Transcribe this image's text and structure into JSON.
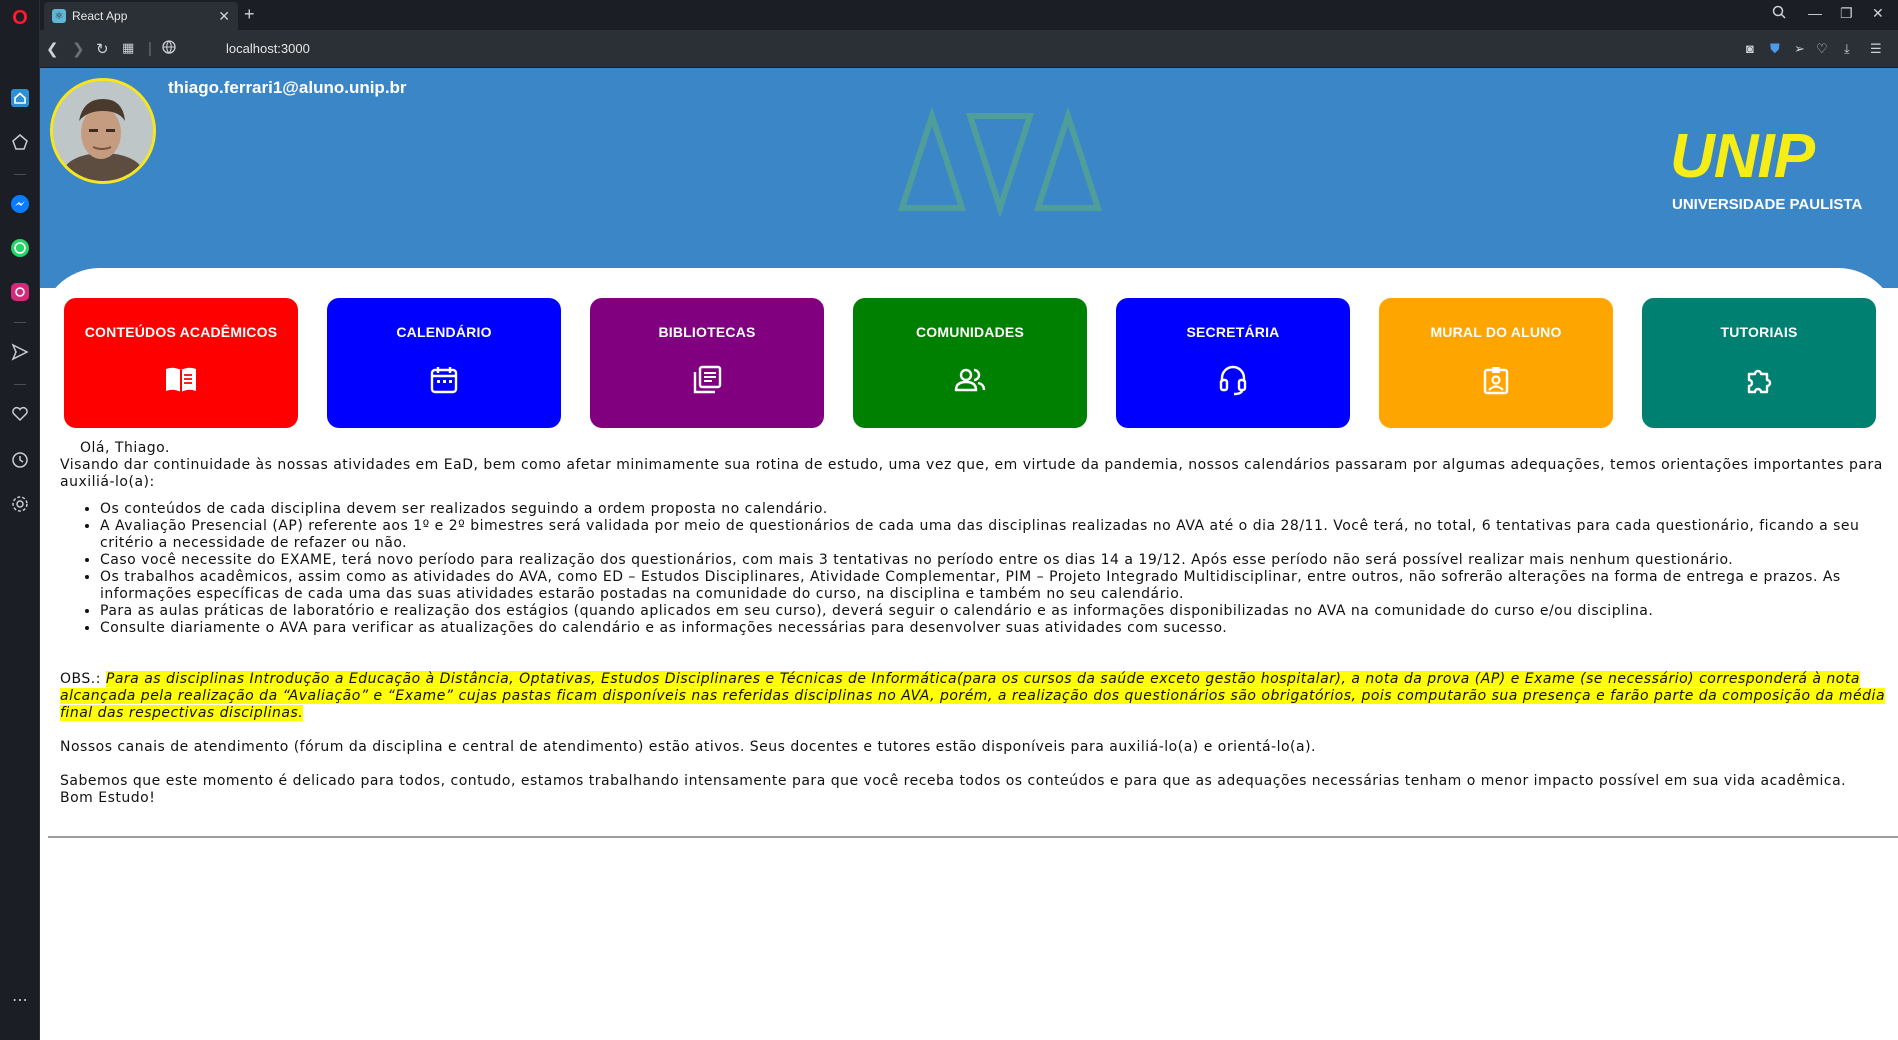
{
  "browser": {
    "tab_title": "React App",
    "url": "localhost:3000"
  },
  "header": {
    "user_email": "thiago.ferrari1@aluno.unip.br",
    "center_logo": "AVA",
    "brand_title": "UNIP",
    "brand_subtitle": "UNIVERSIDADE PAULISTA"
  },
  "nav_cards": [
    {
      "label": "CONTEÚDOS ACADÊMICOS",
      "color": "#ff0000",
      "icon": "book-open-icon"
    },
    {
      "label": "CALENDÁRIO",
      "color": "#0000ff",
      "icon": "calendar-icon"
    },
    {
      "label": "BIBLIOTECAS",
      "color": "#800080",
      "icon": "library-icon"
    },
    {
      "label": "COMUNIDADES",
      "color": "#008000",
      "icon": "people-icon"
    },
    {
      "label": "SECRETÁRIA",
      "color": "#0000ff",
      "icon": "headset-icon"
    },
    {
      "label": "MURAL DO ALUNO",
      "color": "#ffa500",
      "icon": "badge-icon"
    },
    {
      "label": "TUTORIAIS",
      "color": "#008070",
      "icon": "puzzle-icon"
    }
  ],
  "message": {
    "greeting": "Olá, Thiago.",
    "intro": "Visando dar continuidade às nossas atividades em EaD, bem como afetar minimamente sua rotina de estudo, uma vez que, em virtude da pandemia, nossos calendários passaram por algumas adequações, temos orientações importantes para auxiliá-lo(a):",
    "items": [
      "Os conteúdos de cada disciplina devem ser realizados seguindo a ordem proposta no calendário.",
      "A Avaliação Presencial (AP) referente aos 1º e 2º bimestres será validada por meio de questionários de cada uma das disciplinas realizadas no AVA até o dia 28/11. Você terá, no total, 6 tentativas para cada questionário, ficando a seu critério a necessidade de refazer ou não.",
      "Caso você necessite do EXAME, terá novo período para realização dos questionários, com mais 3 tentativas no período entre os dias 14 a 19/12. Após esse período não será possível realizar mais nenhum questionário.",
      "Os trabalhos acadêmicos, assim como as atividades do AVA, como ED – Estudos Disciplinares, Atividade Complementar, PIM – Projeto Integrado Multidisciplinar, entre outros, não sofrerão alterações na forma de entrega e prazos. As informações específicas de cada uma das suas atividades estarão postadas na comunidade do curso, na disciplina e também no seu calendário.",
      "Para as aulas práticas de laboratório e realização dos estágios (quando aplicados em seu curso), deverá seguir o calendário e as informações disponibilizadas no AVA na comunidade do curso e/ou disciplina.",
      "Consulte diariamente o AVA para verificar as atualizações do calendário e as informações necessárias para desenvolver suas atividades com sucesso."
    ],
    "obs_label": "OBS.:",
    "obs_text": "Para as disciplinas Introdução a Educação à Distância, Optativas, Estudos Disciplinares e Técnicas de Informática(para os cursos da saúde exceto gestão hospitalar), a nota da prova (AP) e Exame (se necessário) corresponderá à nota alcançada pela realização da “Avaliação” e “Exame” cujas pastas ficam disponíveis nas referidas disciplinas no AVA, porém, a realização dos questionários são obrigatórios, pois computarão sua presença e farão parte da composição da média final das respectivas disciplinas.",
    "channels": "Nossos canais de atendimento (fórum da disciplina e central de atendimento) estão ativos. Seus docentes e tutores estão disponíveis para auxiliá-lo(a) e orientá-lo(a).",
    "closing": "Sabemos que este momento é delicado para todos, contudo, estamos trabalhando intensamente para que você receba todos os conteúdos e para que as adequações necessárias tenham o menor impacto possível em sua vida acadêmica.",
    "signoff": "Bom Estudo!"
  }
}
